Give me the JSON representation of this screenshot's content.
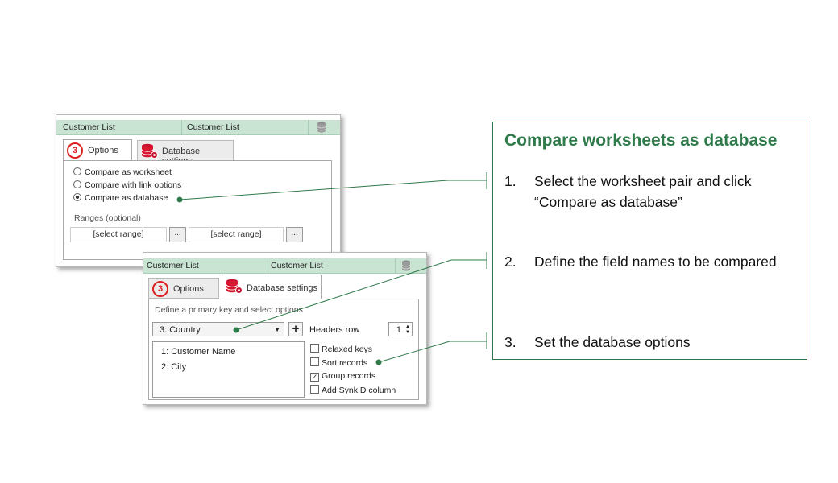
{
  "panel_top": {
    "title_left": "Customer List",
    "title_right": "Customer List",
    "tab_options": {
      "step": "3",
      "label": "Options"
    },
    "tab_database": {
      "label": "Database settings"
    },
    "radios": [
      {
        "label": "Compare as worksheet",
        "selected": false
      },
      {
        "label": "Compare with link options",
        "selected": false
      },
      {
        "label": "Compare as database",
        "selected": true
      }
    ],
    "ranges_label": "Ranges (optional)",
    "range_left": "[select range]",
    "range_right": "[select range]",
    "dots": "..."
  },
  "panel_bottom": {
    "title_left": "Customer List",
    "title_right": "Customer List",
    "tab_options": {
      "step": "3",
      "label": "Options"
    },
    "tab_database": {
      "label": "Database settings"
    },
    "instruction": "Define a primary key and select options",
    "key_select": "3: Country",
    "plus": "+",
    "headers_row_label": "Headers row",
    "headers_row_value": "1",
    "key_list": [
      "1: Customer Name",
      "2: City"
    ],
    "checkboxes": [
      {
        "label": "Relaxed keys",
        "checked": false
      },
      {
        "label": "Sort records",
        "checked": false
      },
      {
        "label": "Group records",
        "checked": true
      },
      {
        "label": "Add SynkID column",
        "checked": false
      }
    ]
  },
  "callout": {
    "title": "Compare worksheets as database",
    "steps": [
      {
        "num": "1.",
        "text": "Select the worksheet pair and click “Compare as database”"
      },
      {
        "num": "2.",
        "text": "Define the field names to be compared"
      },
      {
        "num": "3.",
        "text": "Set the database options"
      }
    ]
  },
  "colors": {
    "accent_green": "#2f7a4a",
    "titlebar_green": "#c9e4d2",
    "step_red": "#dd2222"
  },
  "icons": {
    "database": "database-icon",
    "database_gear": "database-settings-icon",
    "dropdown": "chevron-down-icon"
  }
}
